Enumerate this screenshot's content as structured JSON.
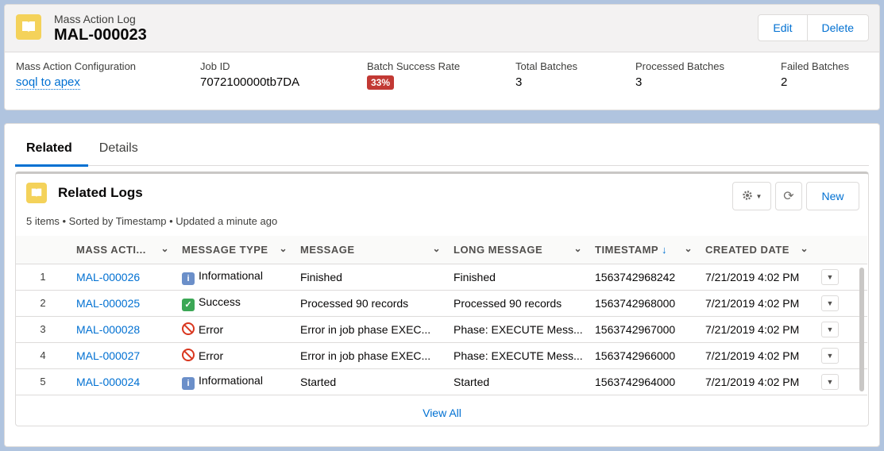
{
  "header": {
    "object_type": "Mass Action Log",
    "record_name": "MAL-000023",
    "icon": "log-book-icon",
    "buttons": {
      "edit": "Edit",
      "delete": "Delete"
    },
    "fields": {
      "config_label": "Mass Action Configuration",
      "config_value": "soql to apex",
      "job_label": "Job ID",
      "job_value": "7072100000tb7DA",
      "rate_label": "Batch Success Rate",
      "rate_value": "33%",
      "total_label": "Total Batches",
      "total_value": "3",
      "processed_label": "Processed Batches",
      "processed_value": "3",
      "failed_label": "Failed Batches",
      "failed_value": "2"
    }
  },
  "tabs": [
    "Related",
    "Details"
  ],
  "related": {
    "title": "Related Logs",
    "subtitle": "5 items • Sorted by Timestamp • Updated a minute ago",
    "new_label": "New",
    "columns": [
      "MASS ACTI...",
      "MESSAGE TYPE",
      "MESSAGE",
      "LONG MESSAGE",
      "TIMESTAMP",
      "CREATED DATE"
    ],
    "rows": [
      {
        "num": "1",
        "name": "MAL-000026",
        "type_icon": "info",
        "type": "Informational",
        "message": "Finished",
        "long": "Finished",
        "timestamp": "1563742968242",
        "created": "7/21/2019 4:02 PM"
      },
      {
        "num": "2",
        "name": "MAL-000025",
        "type_icon": "ok",
        "type": "Success",
        "message": "Processed 90 records",
        "long": "Processed 90 records",
        "timestamp": "1563742968000",
        "created": "7/21/2019 4:02 PM"
      },
      {
        "num": "3",
        "name": "MAL-000028",
        "type_icon": "err",
        "type": "Error",
        "message": "Error in job phase EXEC...",
        "long": "Phase: EXECUTE Mess...",
        "timestamp": "1563742967000",
        "created": "7/21/2019 4:02 PM"
      },
      {
        "num": "4",
        "name": "MAL-000027",
        "type_icon": "err",
        "type": "Error",
        "message": "Error in job phase EXEC...",
        "long": "Phase: EXECUTE Mess...",
        "timestamp": "1563742966000",
        "created": "7/21/2019 4:02 PM"
      },
      {
        "num": "5",
        "name": "MAL-000024",
        "type_icon": "info",
        "type": "Informational",
        "message": "Started",
        "long": "Started",
        "timestamp": "1563742964000",
        "created": "7/21/2019 4:02 PM"
      }
    ],
    "view_all": "View All"
  },
  "colors": {
    "brand": "#0070d2",
    "badge_error": "#c23934",
    "icon_bg": "#f4d25a",
    "page_bg": "#b0c4df"
  }
}
